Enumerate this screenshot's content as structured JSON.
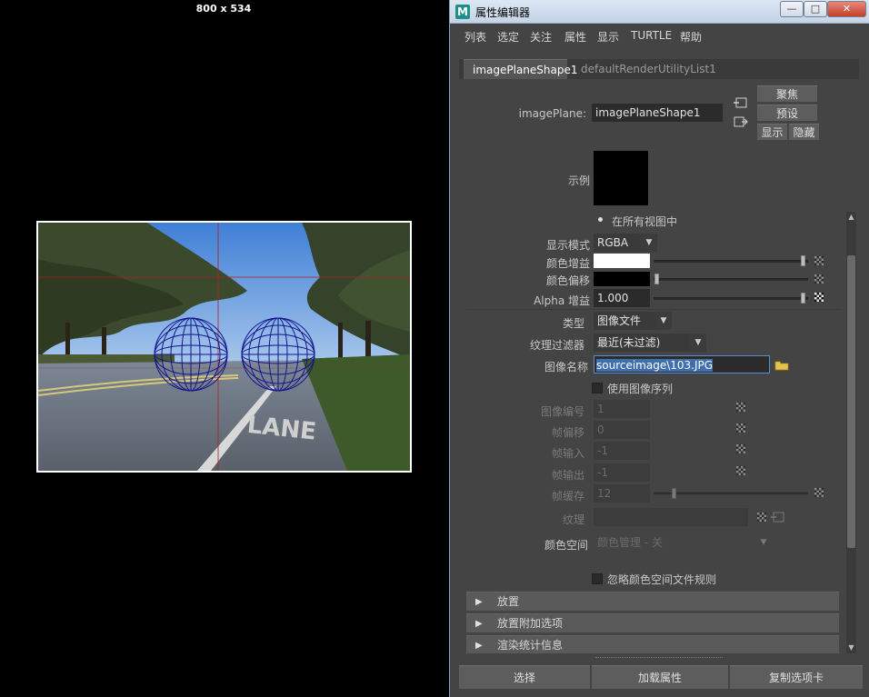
{
  "viewport": {
    "resolution": "800 x 534",
    "image_text": "LANE"
  },
  "window": {
    "app_icon": "M",
    "title": "属性编辑器",
    "minimize": "—",
    "maximize": "□",
    "close": "✕"
  },
  "menu": [
    "列表",
    "选定",
    "关注",
    "属性",
    "显示",
    "TURTLE",
    "帮助"
  ],
  "tabs": [
    "imagePlaneShape1",
    "defaultRenderUtilityList1"
  ],
  "node": {
    "label": "imagePlane:",
    "value": "imagePlaneShape1",
    "focus_button": "聚焦",
    "presets_button": "预设",
    "show_button": "显示",
    "hide_button": "隐藏",
    "sample_label": "示例"
  },
  "attributes": {
    "all_views_option": "在所有视图中",
    "display_mode_label": "显示模式",
    "display_mode_value": "RGBA",
    "color_gain_label": "颜色增益",
    "color_offset_label": "颜色偏移",
    "color_gain_value": "#ffffff",
    "color_offset_value": "#000000",
    "alpha_gain_label": "Alpha 增益",
    "alpha_gain_value": "1.000",
    "type_label": "类型",
    "type_value": "图像文件",
    "texture_filter_label": "纹理过滤器",
    "texture_filter_value": "最近(未过滤)",
    "image_name_label": "图像名称",
    "image_name_value": "sourceimage\\103.JPG",
    "use_sequence_label": "使用图像序列",
    "image_number_label": "图像编号",
    "image_number_value": "1",
    "frame_offset_label": "帧偏移",
    "frame_offset_value": "0",
    "frame_in_label": "帧输入",
    "frame_in_value": "-1",
    "frame_out_label": "帧输出",
    "frame_out_value": "-1",
    "frame_cache_label": "帧缓存",
    "frame_cache_value": "12",
    "texture_label": "纹理",
    "color_space_label": "颜色空间",
    "color_space_value": "颜色管理 - 关",
    "ignore_color_space_label": "忽略颜色空间文件规则"
  },
  "sections": [
    "放置",
    "放置附加选项",
    "渲染统计信息"
  ],
  "bottom_buttons": [
    "选择",
    "加载属性",
    "复制选项卡"
  ],
  "icons": [
    "folder-icon",
    "input-connection-icon",
    "output-connection-icon",
    "map-button-icon"
  ]
}
